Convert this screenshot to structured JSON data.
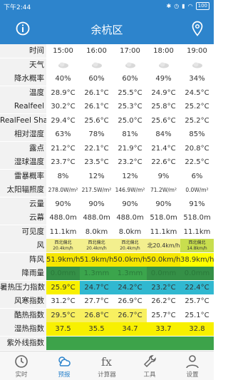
{
  "status": {
    "time": "下午2:44",
    "battery": "100"
  },
  "header": {
    "title": "余杭区"
  },
  "rows": [
    {
      "label": "时间",
      "cells": [
        "15:00",
        "16:00",
        "17:00",
        "18:00",
        "19:00"
      ]
    },
    {
      "label": "天气",
      "cells": [
        "",
        "",
        "",
        "",
        ""
      ]
    },
    {
      "label": "降水概率",
      "cells": [
        "40%",
        "60%",
        "60%",
        "49%",
        "34%"
      ]
    },
    {
      "label": "温度",
      "cells": [
        "28.9°C",
        "26.1°C",
        "25.5°C",
        "24.9°C",
        "24.5°C"
      ]
    },
    {
      "label": "Realfeel",
      "cells": [
        "30.2°C",
        "26.1°C",
        "25.3°C",
        "25.8°C",
        "25.2°C"
      ]
    },
    {
      "label": "RealFeel Shade",
      "cells": [
        "29.4°C",
        "25.6°C",
        "25.0°C",
        "25.6°C",
        "25.2°C"
      ]
    },
    {
      "label": "相对湿度",
      "cells": [
        "63%",
        "78%",
        "81%",
        "84%",
        "85%"
      ]
    },
    {
      "label": "露点",
      "cells": [
        "21.2°C",
        "22.1°C",
        "21.9°C",
        "21.4°C",
        "20.8°C"
      ]
    },
    {
      "label": "湿球温度",
      "cells": [
        "23.7°C",
        "23.5°C",
        "23.2°C",
        "22.6°C",
        "22.5°C"
      ]
    },
    {
      "label": "雷暴概率",
      "cells": [
        "8%",
        "12%",
        "12%",
        "9%",
        "6%"
      ]
    },
    {
      "label": "太阳辐照度",
      "cells": [
        "278.0W/m²",
        "217.5W/m²",
        "146.9W/m²",
        "71.2W/m²",
        "0.0W/m²"
      ]
    },
    {
      "label": "云量",
      "cells": [
        "90%",
        "90%",
        "90%",
        "90%",
        "91%"
      ]
    },
    {
      "label": "云幕",
      "cells": [
        "488.0m",
        "488.0m",
        "488.0m",
        "518.0m",
        "518.0m"
      ]
    },
    {
      "label": "可见度",
      "cells": [
        "11.1km",
        "8.0km",
        "8.0km",
        "11.1km",
        "11.1km"
      ]
    },
    {
      "label": "风",
      "cells": [
        "西北偏北 20.4km/h",
        "西北偏北 20.4km/h",
        "西北偏北 20.4km/h",
        "北20.4km/h",
        "西北偏北 14.8km/h"
      ]
    },
    {
      "label": "阵风",
      "cells": [
        "51.9km/h",
        "51.9km/h",
        "50.0km/h",
        "50.0km/h",
        "38.9km/h"
      ]
    },
    {
      "label": "降雨量",
      "cells": [
        "0.0mm",
        "1.3mm",
        "1.3mm",
        "0.0mm",
        "0.0mm"
      ]
    },
    {
      "label": "暑热压力指数",
      "cells": [
        "25.9°C",
        "24.7°C",
        "24.2°C",
        "23.2°C",
        "22.4°C"
      ]
    },
    {
      "label": "风寒指数",
      "cells": [
        "31.2°C",
        "27.7°C",
        "26.9°C",
        "26.2°C",
        "25.7°C"
      ]
    },
    {
      "label": "酷热指数",
      "cells": [
        "29.5°C",
        "26.8°C",
        "26.7°C",
        "25.7°C",
        "25.1°C"
      ]
    },
    {
      "label": "湿热指数",
      "cells": [
        "37.5",
        "35.5",
        "34.7",
        "33.7",
        "32.8"
      ]
    },
    {
      "label": "紫外线指数",
      "cells": [
        "",
        "",
        "",
        "",
        ""
      ]
    }
  ],
  "colors": {
    "wind": [
      "#f3ef8e",
      "#f3ef8e",
      "#f3ef8e",
      "#f3ef8e",
      "#c8de4e"
    ],
    "gust": [
      "#f6e600",
      "#f6e600",
      "#f6e600",
      "#f6e600",
      "#ffff00"
    ],
    "rain": [
      "#359047",
      "#3ba54c",
      "#3ba54c",
      "#359047",
      "#359047"
    ],
    "heat_stress": [
      "#f8f000",
      "#30b8d0",
      "#30b8d0",
      "#30b8d0",
      "#30b8d0"
    ],
    "heat_index": [
      "#f8f060",
      "#f8f060",
      "#f8f060",
      "#ffffff",
      "#ffffff"
    ],
    "humidex": [
      "#f8f000",
      "#f8f000",
      "#f8f000",
      "#f8f000",
      "#f8f000"
    ],
    "uv": [
      "#3da34a",
      "#3da34a",
      "#3da34a",
      "#3da34a",
      "#3da34a"
    ]
  },
  "tabs": [
    {
      "label": "实时",
      "icon": "clock-icon"
    },
    {
      "label": "预报",
      "icon": "weather-icon"
    },
    {
      "label": "计算器",
      "icon": "fx-icon"
    },
    {
      "label": "工具",
      "icon": "wrench-icon"
    },
    {
      "label": "设置",
      "icon": "user-icon"
    }
  ],
  "active_tab": 1
}
